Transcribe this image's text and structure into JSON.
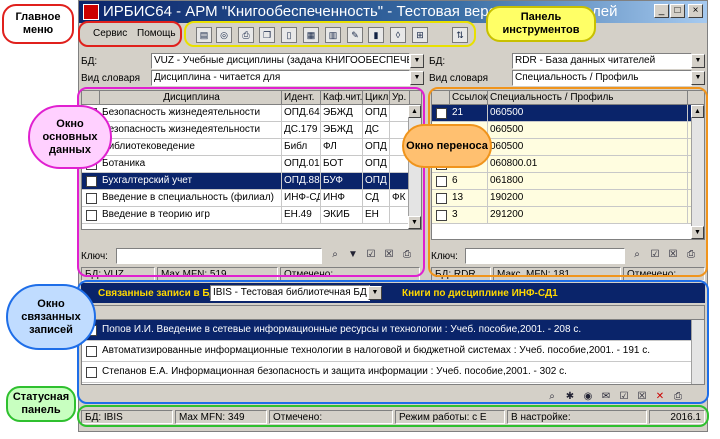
{
  "window": {
    "title": "ИРБИС64 - АРМ \"Книгообеспеченность\" - Тестовая версия для читателей",
    "controls": [
      "_",
      "□",
      "×"
    ]
  },
  "menu": {
    "items": [
      "Сервис",
      "Помощь"
    ]
  },
  "toolbar": {
    "icons": [
      "document-icon",
      "target-icon",
      "print-icon",
      "copy-icon",
      "page-icon",
      "report-icon",
      "table-icon",
      "edit-icon",
      "books-icon",
      "filter-icon",
      "tree-icon",
      "sort-icon"
    ]
  },
  "left": {
    "db_label": "БД:",
    "db_value": "VUZ - Учебные дисциплины (задача КНИГООБЕСПЕЧЕН",
    "dict_label": "Вид словаря",
    "dict_value": "Дисциплина - читается для",
    "columns": [
      "",
      "Дисциплина",
      "Идент.",
      "Каф.чит.",
      "Цикл",
      "Ур."
    ],
    "rows": [
      [
        "Безопасность жизнедеятельности",
        "ОПД.64",
        "ЭБЖД",
        "ОПД",
        ""
      ],
      [
        "Безопасность жизнедеятельности",
        "ДС.179",
        "ЭБЖД",
        "ДС",
        ""
      ],
      [
        "Библиотековедение",
        "Библ",
        "ФЛ",
        "ОПД",
        ""
      ],
      [
        "Ботаника",
        "ОПД.01",
        "БОТ",
        "ОПД",
        ""
      ],
      [
        "Бухгалтерский учет",
        "ОПД.88",
        "БУФ",
        "ОПД",
        ""
      ],
      [
        "Введение в специальность (филиал)",
        "ИНФ-СД",
        "ИНФ",
        "СД",
        "ФК"
      ],
      [
        "Введение в теорию игр",
        "ЕН.49",
        "ЭКИБ",
        "ЕН",
        ""
      ]
    ],
    "selected_row": 4,
    "key_label": "Ключ:",
    "status": [
      "БД: VUZ",
      "Max MFN: 519",
      "Отмечено:"
    ]
  },
  "right": {
    "db_label": "БД:",
    "db_value": "RDR - База данных читателей",
    "dict_label": "Вид словаря",
    "dict_value": "Специальность / Профиль",
    "columns": [
      "",
      "Ссылок",
      "Специальность / Профиль"
    ],
    "rows": [
      [
        "21",
        "060500"
      ],
      [
        "",
        "060500"
      ],
      [
        "",
        "060500"
      ],
      [
        "2",
        "060800.01"
      ],
      [
        "6",
        "061800"
      ],
      [
        "13",
        "190200"
      ],
      [
        "3",
        "291200"
      ]
    ],
    "selected_row": 0,
    "key_label": "Ключ:",
    "status": [
      "БД: RDR",
      "Макс. MFN: 181",
      "Отмечено:"
    ]
  },
  "related": {
    "label": "Связанные записи в БД:",
    "db_value": "IBIS - Тестовая библиотечная БД",
    "caption": "Книги по дисциплине ИНФ-СД1",
    "rows": [
      "Попов И.И. Введение в сетевые информационные ресурсы и технологии : Учеб. пособие,2001. - 208 с.",
      "Автоматизированные информационные технологии в налоговой и бюджетной системах : Учеб. пособие,2001. - 191 с.",
      "Степанов Е.А. Информационная безопасность и защита информации : Учеб. пособие,2001. - 302 с."
    ],
    "selected_row": 0
  },
  "statusbar": {
    "items": [
      "БД: IBIS",
      "Max MFN: 349",
      "Отмечено:",
      "Режим работы: с Е",
      "В настройке:",
      "2016.1"
    ]
  },
  "callouts": {
    "main_menu": "Главное меню",
    "toolbar_panel": "Панель инструментов",
    "main_data": "Окно основных данных",
    "transfer": "Окно переноса",
    "related_records": "Окно связанных записей",
    "status_panel": "Статусная панель"
  },
  "colors": {
    "menu_frame": "#e0201c",
    "toolbar_frame": "#e8e000",
    "main_frame": "#e020d0",
    "transfer_frame": "#f0941c",
    "related_frame": "#1e6ee8",
    "status_frame": "#2fc02f",
    "selection": "#0a246a"
  }
}
